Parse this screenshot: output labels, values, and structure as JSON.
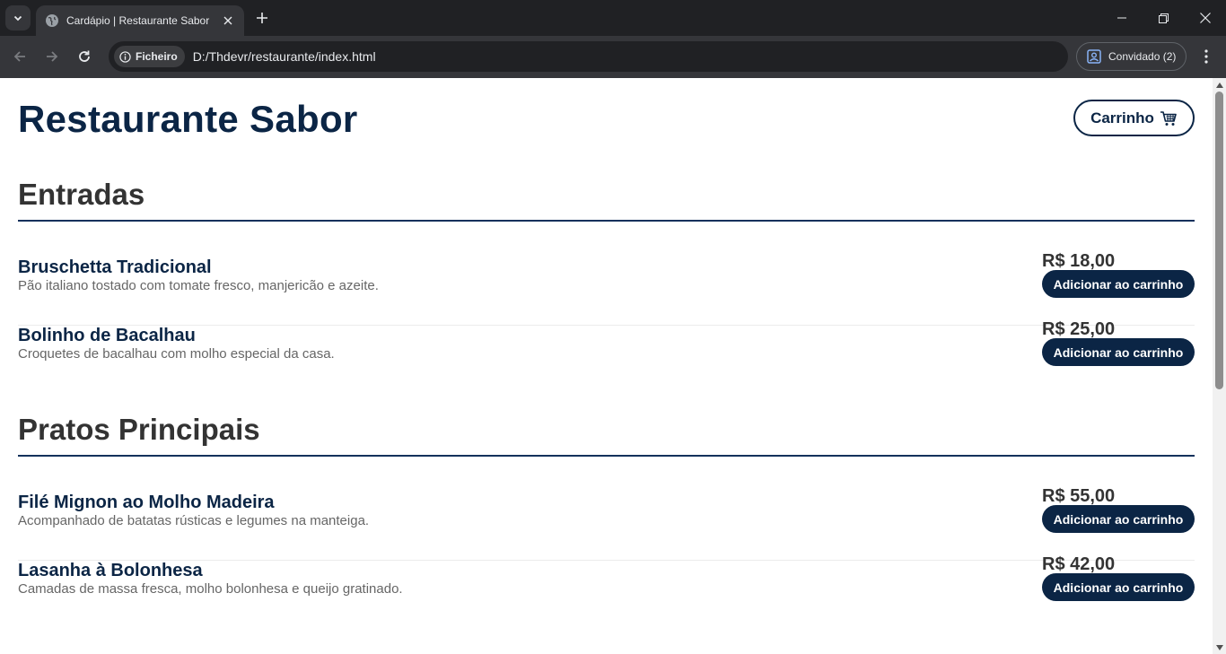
{
  "browser": {
    "tab_title": "Cardápio | Restaurante Sabor",
    "security_chip": "Ficheiro",
    "url": "D:/Thdevr/restaurante/index.html",
    "profile_label": "Convidado (2)"
  },
  "page": {
    "site_title": "Restaurante Sabor",
    "cart_label": "Carrinho",
    "sections": [
      {
        "title": "Entradas",
        "items": [
          {
            "name": "Bruschetta Tradicional",
            "description": "Pão italiano tostado com tomate fresco, manjericão e azeite.",
            "price": "R$ 18,00",
            "button": "Adicionar ao carrinho"
          },
          {
            "name": "Bolinho de Bacalhau",
            "description": "Croquetes de bacalhau com molho especial da casa.",
            "price": "R$ 25,00",
            "button": "Adicionar ao carrinho"
          }
        ]
      },
      {
        "title": "Pratos Principais",
        "items": [
          {
            "name": "Filé Mignon ao Molho Madeira",
            "description": "Acompanhado de batatas rústicas e legumes na manteiga.",
            "price": "R$ 55,00",
            "button": "Adicionar ao carrinho"
          },
          {
            "name": "Lasanha à Bolonhesa",
            "description": "Camadas de massa fresca, molho bolonhesa e queijo gratinado.",
            "price": "R$ 42,00",
            "button": "Adicionar ao carrinho"
          }
        ]
      }
    ]
  },
  "colors": {
    "primary": "#0b2545",
    "heading": "#333333",
    "description": "#666666",
    "rule": "#13315c"
  }
}
